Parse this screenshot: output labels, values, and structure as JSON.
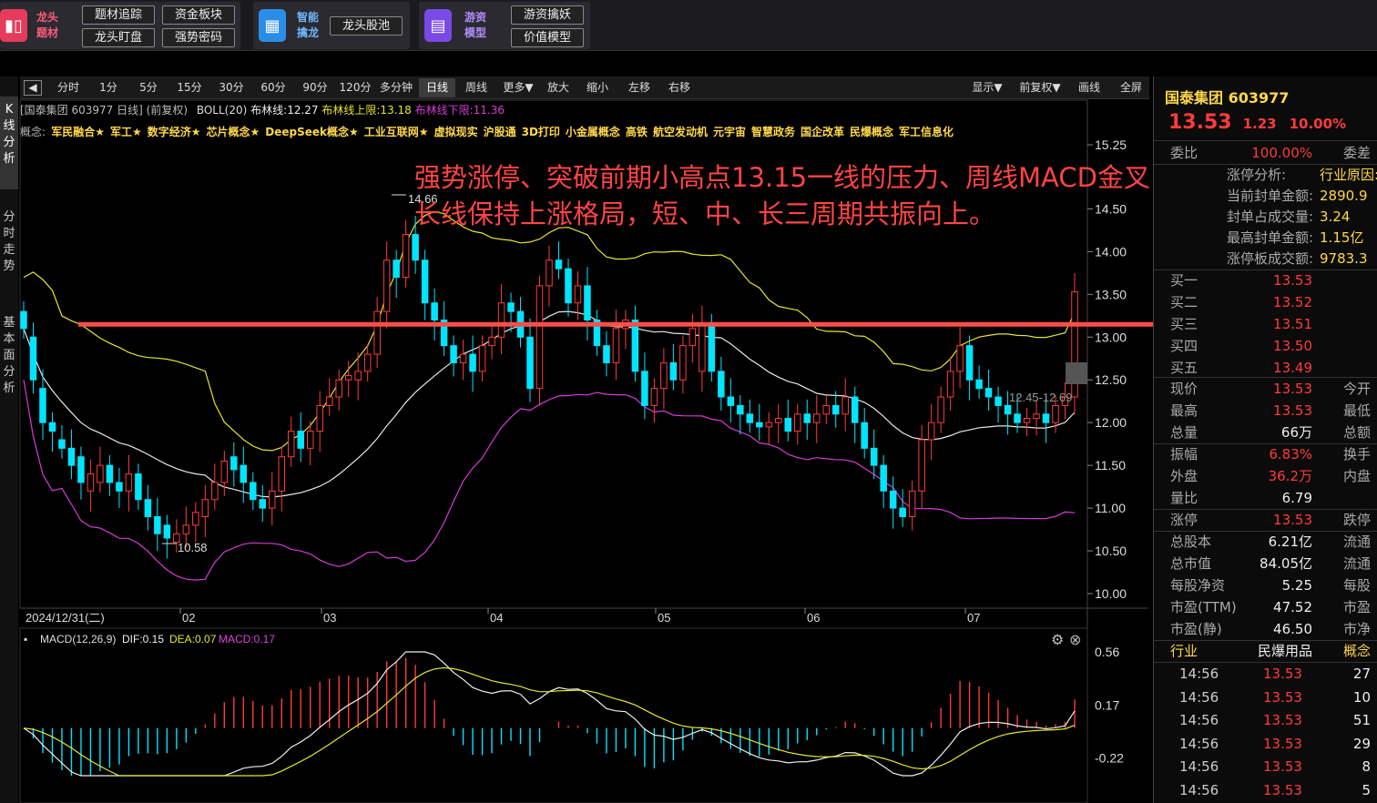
{
  "topbar": {
    "group1": {
      "title": "龙头题材",
      "buttons": [
        "题材追踪",
        "资金板块",
        "龙头盯盘",
        "强势密码"
      ]
    },
    "group2": {
      "title": "智能擒龙",
      "buttons": [
        "龙头股池"
      ]
    },
    "group3": {
      "title": "游资模型",
      "buttons": [
        "游资擒妖",
        "价值模型"
      ]
    }
  },
  "toolbar": {
    "left": [
      "分时",
      "1分",
      "5分",
      "15分",
      "30分",
      "60分",
      "90分",
      "120分",
      "多分钟",
      "日线",
      "周线",
      "更多▼",
      "放大",
      "缩小",
      "左移",
      "右移"
    ],
    "active": "日线",
    "right": [
      "显示▼",
      "前复权▼",
      "画线",
      "全屏"
    ]
  },
  "left_tabs": [
    "K线分析",
    "分时走势",
    "基本面分析"
  ],
  "chart_header": {
    "stock": "[国泰集团 603977 日线]",
    "adj": "(前复权)",
    "indicator": "BOLL(20)",
    "mid": "布林线:12.27",
    "upper": "布林线上限:13.18",
    "lower": "布林线下限:11.36"
  },
  "concepts": {
    "label": "概念:",
    "items": [
      "军民融合★",
      "军工★",
      "数字经济★",
      "芯片概念★",
      "DeepSeek概念★",
      "工业互联网★",
      "虚拟现实",
      "沪股通",
      "3D打印",
      "小金属概念",
      "高铁",
      "航空发动机",
      "元宇宙",
      "智慧政务",
      "国企改革",
      "民爆概念",
      "军工信息化"
    ]
  },
  "annotation": "强势涨停、突破前期小高点13.15一线的压力、周线MACD金叉，长线保持上涨格局，短、中、长三周期共振向上。",
  "labels": {
    "high": "14.66",
    "low": "10.58",
    "range": "12.45-12.69",
    "date": "2024/12/31(二)"
  },
  "macd_header": {
    "name": "MACD(12,26,9)",
    "dif": "DIF:0.15",
    "dea": "DEA:0.07",
    "macd": "MACD:0.17"
  },
  "colors": {
    "up": "#ff3b3b",
    "down": "#00e5ff",
    "line": "#ff4d4d",
    "boll_upper": "#e6e62e",
    "boll_mid": "#e8e8e8",
    "boll_lower": "#d63bd6"
  },
  "chart_data": {
    "type": "candlestick",
    "title": "",
    "price_axis": {
      "min": 10.0,
      "max": 15.25,
      "ticks": [
        "15.25",
        "14.50",
        "14.00",
        "13.50",
        "13.00",
        "12.50",
        "12.00",
        "11.50",
        "11.00",
        "10.50",
        "10.00"
      ]
    },
    "month_ticks": [
      "02",
      "03",
      "04",
      "05",
      "06",
      "07"
    ],
    "macd_axis": {
      "min": -0.35,
      "max": 0.56,
      "ticks": [
        "0.56",
        "0.17",
        "-0.22"
      ]
    },
    "resistance_level": 13.15,
    "closes": [
      13.1,
      12.5,
      12.0,
      11.9,
      11.7,
      11.5,
      11.3,
      11.4,
      11.5,
      11.3,
      11.2,
      11.4,
      11.1,
      10.9,
      10.7,
      10.65,
      10.7,
      10.8,
      10.95,
      11.1,
      11.3,
      11.55,
      11.45,
      11.3,
      11.1,
      11.0,
      11.2,
      11.6,
      11.9,
      11.7,
      11.9,
      12.2,
      12.3,
      12.5,
      12.55,
      12.6,
      12.8,
      13.3,
      13.9,
      13.7,
      14.2,
      13.9,
      13.4,
      13.2,
      12.9,
      12.7,
      12.8,
      12.6,
      12.9,
      13.0,
      13.4,
      13.3,
      13.0,
      12.4,
      13.6,
      13.9,
      13.8,
      13.4,
      13.6,
      13.2,
      12.9,
      12.7,
      13.1,
      13.2,
      12.6,
      12.2,
      12.4,
      12.7,
      12.5,
      12.9,
      13.1,
      13.15,
      12.6,
      12.3,
      12.2,
      12.1,
      12.0,
      11.95,
      12.0,
      12.05,
      11.9,
      12.1,
      12.0,
      12.1,
      12.2,
      12.1,
      12.3,
      12.0,
      11.7,
      11.5,
      11.2,
      11.0,
      10.9,
      11.2,
      11.8,
      12.0,
      12.3,
      12.6,
      12.9,
      12.5,
      12.4,
      12.3,
      12.2,
      12.1,
      12.0,
      12.05,
      12.1,
      12.0,
      12.2,
      12.3,
      13.53
    ],
    "opens": [
      13.3,
      13.0,
      12.4,
      12.0,
      11.8,
      11.7,
      11.6,
      11.2,
      11.3,
      11.5,
      11.3,
      11.2,
      11.4,
      11.1,
      10.9,
      10.8,
      10.6,
      10.7,
      10.8,
      10.9,
      11.1,
      11.3,
      11.6,
      11.5,
      11.3,
      11.1,
      11.0,
      11.2,
      11.6,
      11.9,
      11.7,
      11.9,
      12.2,
      12.3,
      12.5,
      12.5,
      12.6,
      12.8,
      13.3,
      13.9,
      13.7,
      14.2,
      13.9,
      13.4,
      13.2,
      12.9,
      12.7,
      12.8,
      12.6,
      12.9,
      13.0,
      13.4,
      13.3,
      13.0,
      12.4,
      13.6,
      13.9,
      13.8,
      13.4,
      13.6,
      13.2,
      12.9,
      12.7,
      13.1,
      13.2,
      12.6,
      12.2,
      12.4,
      12.7,
      12.5,
      12.9,
      12.6,
      13.15,
      12.6,
      12.3,
      12.2,
      12.1,
      12.0,
      11.95,
      12.0,
      12.05,
      11.9,
      12.1,
      12.0,
      12.1,
      12.2,
      12.1,
      12.3,
      12.0,
      11.7,
      11.5,
      11.2,
      11.0,
      10.9,
      11.2,
      11.8,
      12.0,
      12.3,
      12.6,
      12.9,
      12.5,
      12.4,
      12.3,
      12.2,
      12.1,
      12.0,
      12.05,
      12.1,
      12.0,
      12.2,
      12.3
    ]
  },
  "right_panel": {
    "name": "国泰集团",
    "code": "603977",
    "price": "13.53",
    "change": "1.23",
    "pct": "10.00%",
    "weibi": {
      "label": "委比",
      "value": "100.00%",
      "right": "委差"
    },
    "limit_info": [
      {
        "label": "涨停分析:",
        "value": "行业原因:"
      },
      {
        "label": "当前封单金额:",
        "value": "2890.9"
      },
      {
        "label": "封单占成交量:",
        "value": "3.24"
      },
      {
        "label": "最高封单金额:",
        "value": "1.15亿"
      },
      {
        "label": "涨停板成交额:",
        "value": "9783.3"
      }
    ],
    "order_book": [
      {
        "label": "买一",
        "price": "13.53"
      },
      {
        "label": "买二",
        "price": "13.52"
      },
      {
        "label": "买三",
        "price": "13.51"
      },
      {
        "label": "买四",
        "price": "13.50"
      },
      {
        "label": "买五",
        "price": "13.49"
      }
    ],
    "stats1": [
      {
        "label": "现价",
        "value": "13.53",
        "right": "今开",
        "red": true
      },
      {
        "label": "最高",
        "value": "13.53",
        "right": "最低",
        "red": true
      },
      {
        "label": "总量",
        "value": "66万",
        "right": "总额",
        "red": false
      }
    ],
    "stats2": [
      {
        "label": "振幅",
        "value": "6.83%",
        "right": "换手",
        "red": true
      },
      {
        "label": "外盘",
        "value": "36.2万",
        "right": "内盘",
        "red": true
      },
      {
        "label": "量比",
        "value": "6.79",
        "right": "",
        "red": false
      }
    ],
    "stats3": [
      {
        "label": "涨停",
        "value": "13.53",
        "right": "跌停",
        "red": true
      }
    ],
    "stats4": [
      {
        "label": "总股本",
        "value": "6.21亿",
        "right": "流通"
      },
      {
        "label": "总市值",
        "value": "84.05亿",
        "right": "流通"
      },
      {
        "label": "每股净资",
        "value": "5.25",
        "right": "每股"
      },
      {
        "label": "市盈(TTM)",
        "value": "47.52",
        "right": "市盈"
      },
      {
        "label": "市盈(静)",
        "value": "46.50",
        "right": "市净"
      }
    ],
    "industry": {
      "label": "行业",
      "value": "民爆用品",
      "right": "概念"
    },
    "ticks": [
      {
        "time": "14:56",
        "price": "13.53",
        "vol": "27"
      },
      {
        "time": "14:56",
        "price": "13.53",
        "vol": "10"
      },
      {
        "time": "14:56",
        "price": "13.53",
        "vol": "51"
      },
      {
        "time": "14:56",
        "price": "13.53",
        "vol": "29"
      },
      {
        "time": "14:56",
        "price": "13.53",
        "vol": "8"
      },
      {
        "time": "14:56",
        "price": "13.53",
        "vol": "5"
      }
    ]
  }
}
